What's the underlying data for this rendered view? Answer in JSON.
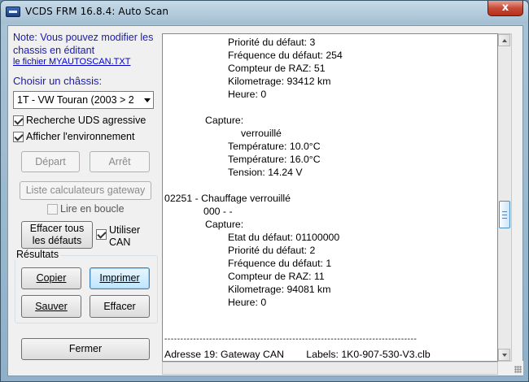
{
  "window": {
    "title": "VCDS FRM 16.8.4:  Auto Scan",
    "close_symbol": "x"
  },
  "left_panel": {
    "note_text": "Note:  Vous pouvez modifier les chassis en éditant",
    "note_link": "le fichier MYAUTOSCAN.TXT",
    "chassis_label": "Choisir un châssis:",
    "chassis_selected": "1T - VW Touran (2003 > 2",
    "checkbox_uds": "Recherche UDS agressive",
    "checkbox_env": "Afficher l'environnement",
    "btn_start": "Départ",
    "btn_stop": "Arrêt",
    "btn_gateway": "Liste calculateurs gateway",
    "checkbox_loop": "Lire en boucle",
    "btn_clear_all_line1": "Effacer tous",
    "btn_clear_all_line2": "les défauts",
    "checkbox_can_line1": "Utiliser",
    "checkbox_can_line2": "CAN",
    "results_label": "Résultats",
    "btn_copy": "Copier",
    "btn_print": "Imprimer",
    "btn_save": "Sauver",
    "btn_erase": "Effacer",
    "btn_close": "Fermer"
  },
  "report_lines": [
    "Priorité du défaut: 3",
    "Fréquence du défaut: 254",
    "Compteur de RAZ: 51",
    "Kilometrage: 93412 km",
    "Heure: 0",
    "Capture:",
    "verrouillé",
    "Température: 10.0°C",
    "Température: 16.0°C",
    "Tension: 14.24 V",
    "02251 - Chauffage verrouillé",
    "000 - -",
    "Capture:",
    "Etat du défaut: 01100000",
    "Priorité du défaut: 2",
    "Fréquence du défaut: 1",
    "Compteur de RAZ: 11",
    "Kilometrage: 94081 km",
    "Heure: 0",
    "-------------------------------------------------------------------------------",
    "Adresse 19: Gateway CAN        Labels: 1K0-907-530-V3.clb"
  ]
}
